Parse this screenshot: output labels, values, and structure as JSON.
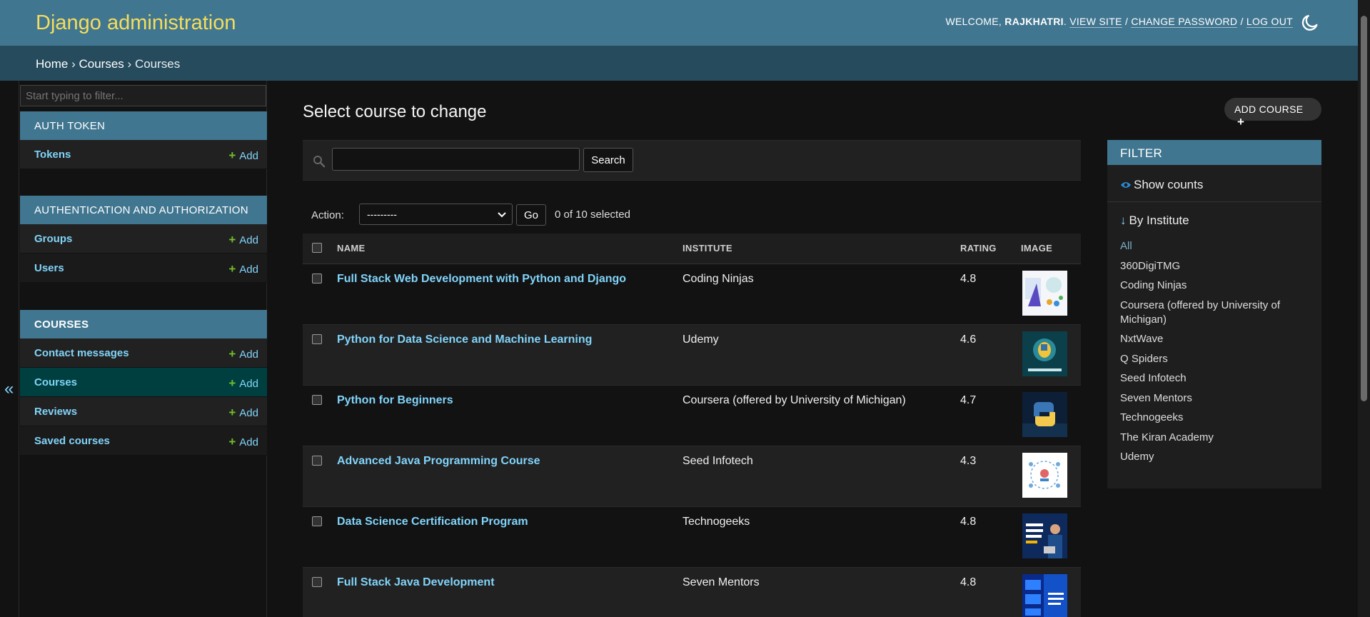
{
  "header": {
    "branding": "Django administration",
    "welcome": "WELCOME,",
    "username": "RAJKHATRI",
    "view_site": "VIEW SITE",
    "change_password": "CHANGE PASSWORD",
    "log_out": "LOG OUT",
    "sep": "/",
    "theme_icon": "moon-icon",
    "bg_color": "#417690",
    "brand_color": "#f5dd5d"
  },
  "breadcrumbs": {
    "home": "Home",
    "app": "Courses",
    "current": "Courses",
    "sep": "›"
  },
  "sidebar": {
    "filter_placeholder": "Start typing to filter...",
    "add_label": "Add",
    "apps": [
      {
        "caption": "AUTH TOKEN",
        "models": [
          "Tokens"
        ]
      },
      {
        "caption": "AUTHENTICATION AND AUTHORIZATION",
        "models": [
          "Groups",
          "Users"
        ]
      },
      {
        "caption": "COURSES",
        "models": [
          "Contact messages",
          "Courses",
          "Reviews",
          "Saved courses"
        ]
      }
    ],
    "collapse_glyph": "«"
  },
  "content": {
    "title": "Select course to change",
    "add_button": "ADD COURSE",
    "search_button": "Search",
    "search_value": "",
    "action_label": "Action:",
    "action_selected": "---------",
    "go_button": "Go",
    "selected_count": "0 of 10 selected",
    "columns": {
      "name": "NAME",
      "institute": "INSTITUTE",
      "rating": "RATING",
      "image": "IMAGE"
    },
    "rows": [
      {
        "name": "Full Stack Web Development with Python and Django",
        "institute": "Coding Ninjas",
        "rating": "4.8"
      },
      {
        "name": "Python for Data Science and Machine Learning",
        "institute": "Udemy",
        "rating": "4.6"
      },
      {
        "name": "Python for Beginners",
        "institute": "Coursera (offered by University of Michigan)",
        "rating": "4.7"
      },
      {
        "name": "Advanced Java Programming Course",
        "institute": "Seed Infotech",
        "rating": "4.3"
      },
      {
        "name": "Data Science Certification Program",
        "institute": "Technogeeks",
        "rating": "4.8"
      },
      {
        "name": "Full Stack Java Development",
        "institute": "Seven Mentors",
        "rating": "4.8"
      }
    ]
  },
  "filter": {
    "title": "FILTER",
    "show_counts": "Show counts",
    "by_institute": "By Institute",
    "arrow": "↓",
    "options": [
      "All",
      "360DigiTMG",
      "Coding Ninjas",
      "Coursera (offered by University of Michigan)",
      "NxtWave",
      "Q Spiders",
      "Seed Infotech",
      "Seven Mentors",
      "Technogeeks",
      "The Kiran Academy",
      "Udemy"
    ]
  }
}
